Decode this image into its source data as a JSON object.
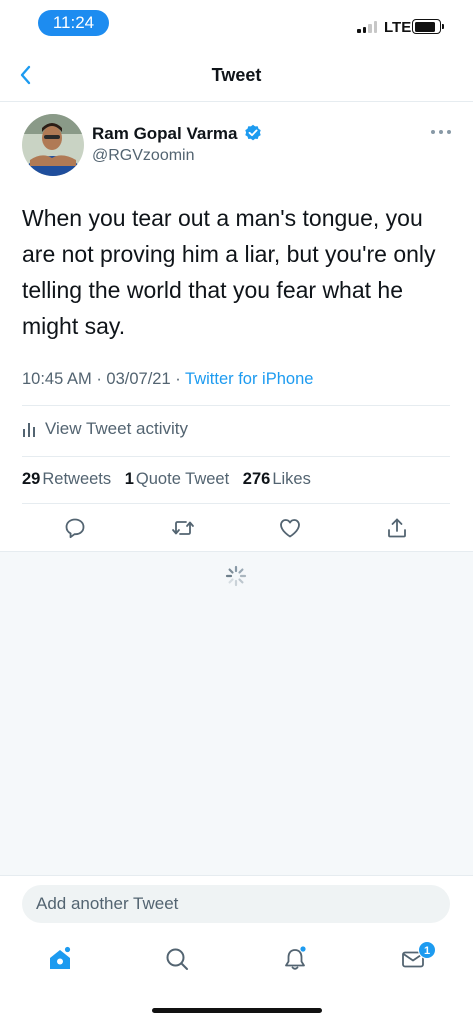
{
  "status_bar": {
    "time": "11:24",
    "network": "LTE",
    "signal_bars_filled": 2,
    "signal_bars_total": 4,
    "battery_level": 0.85
  },
  "nav": {
    "title": "Tweet",
    "back_icon": "chevron-left-icon"
  },
  "tweet": {
    "author_name": "Ram Gopal Varma",
    "author_handle": "@RGVzoomin",
    "verified": true,
    "text": "When you tear out a man's tongue, you are not proving him a liar, but you're only telling the world that you fear what he might say.",
    "time": "10:45 AM",
    "date": "03/07/21",
    "separator": "·",
    "source": "Twitter for iPhone"
  },
  "activity": {
    "label": "View Tweet activity"
  },
  "stats": {
    "retweets_count": "29",
    "retweets_label": "Retweets",
    "quote_count": "1",
    "quote_label": "Quote Tweet",
    "likes_count": "276",
    "likes_label": "Likes"
  },
  "actions": [
    "reply-icon",
    "retweet-icon",
    "like-icon",
    "share-icon"
  ],
  "composer": {
    "placeholder": "Add another Tweet"
  },
  "tabbar": {
    "items": [
      "home-icon",
      "search-icon",
      "notifications-icon",
      "messages-icon"
    ],
    "messages_badge": "1"
  },
  "colors": {
    "accent": "#1d9bf0",
    "time_pill": "#1d8cf0",
    "secondary_text": "#536471",
    "background_gray": "#f5f8fa"
  }
}
